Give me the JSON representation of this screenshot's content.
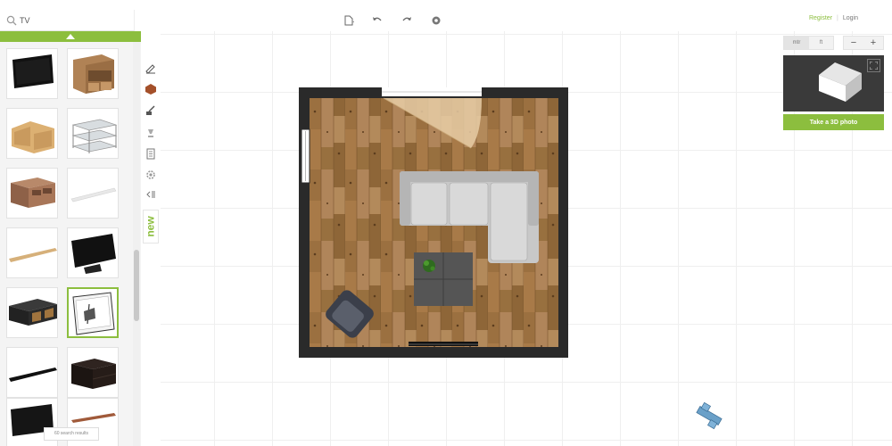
{
  "search": {
    "value": "TV",
    "placeholder": ""
  },
  "header": {
    "tools": [
      "new-file-icon",
      "undo-icon",
      "redo-icon",
      "settings-icon"
    ],
    "register_label": "Register",
    "separator": "|",
    "login_label": "Login"
  },
  "catalog": {
    "items": [
      "flat-screen-tv",
      "wooden-tv-cabinet",
      "corner-tv-stand",
      "glass-tv-stand",
      "wooden-media-console",
      "white-wall-shelf",
      "wooden-wall-shelf",
      "black-flat-tv",
      "black-media-console",
      "wall-mounted-tv-box",
      "black-floating-shelf",
      "dark-tv-cabinet",
      "tv-on-stand",
      "wall-shelf"
    ],
    "selected_index": 9,
    "results_label": "60 search results"
  },
  "side_tools": {
    "items": [
      "draw-wall-icon",
      "floor-material-icon",
      "paint-icon",
      "light-icon",
      "list-icon",
      "settings-wheel-icon",
      "collapse-icon"
    ],
    "new_label": "new"
  },
  "view_controls": {
    "unit_metric": "mtr",
    "unit_imperial": "ft",
    "zoom_out": "−",
    "zoom_in": "+"
  },
  "preview": {
    "take_photo_label": "Take a 3D photo"
  },
  "colors": {
    "accent": "#8cbe3e",
    "wall": "#2a2a2a",
    "floor": "#a47a4a",
    "sofa": "#c8c8c8",
    "table": "#555555"
  }
}
